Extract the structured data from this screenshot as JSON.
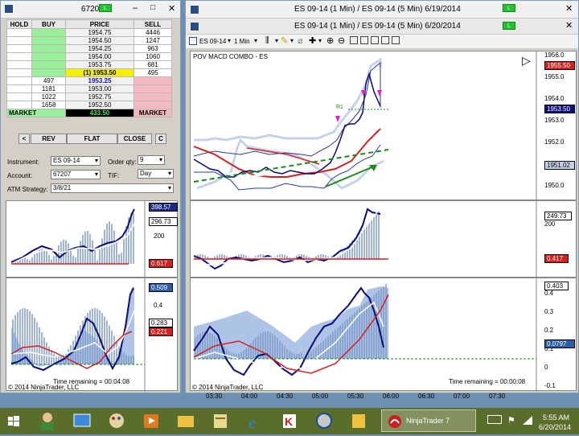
{
  "dom_window": {
    "title": "6720",
    "l_button": "L",
    "hold": "HOLD",
    "buy": "BUY",
    "price": "PRICE",
    "sell": "SELL",
    "rows": [
      {
        "buy": "",
        "price": "1954.75",
        "sell": "4446"
      },
      {
        "buy": "",
        "price": "1954.50",
        "sell": "1247"
      },
      {
        "buy": "",
        "price": "1954.25",
        "sell": "963"
      },
      {
        "buy": "",
        "price": "1954.00",
        "sell": "1060"
      },
      {
        "buy": "",
        "price": "1953.75",
        "sell": "681"
      },
      {
        "buy": "",
        "price": "(1) 1953.50",
        "sell": "495"
      },
      {
        "buy": "497",
        "price": "1953.25",
        "sell": ""
      },
      {
        "buy": "1181",
        "price": "1953.00",
        "sell": ""
      },
      {
        "buy": "1022",
        "price": "1952.75",
        "sell": ""
      },
      {
        "buy": "1658",
        "price": "1952.50",
        "sell": ""
      }
    ],
    "market_left": "MARKET",
    "pnl": "433.50",
    "market_right": "MARKET",
    "btn_lt": "<",
    "btn_rev": "REV",
    "btn_flat": "FLAT",
    "btn_close": "CLOSE",
    "btn_c": "C",
    "instrument_label": "Instrument:",
    "instrument": "ES 09-14",
    "orderqty_label": "Order qty:",
    "orderqty": "9",
    "account_label": "Account:",
    "account": "67207",
    "tif_label": "TIF:",
    "tif": "Day",
    "atm_label": "ATM Strategy:",
    "atm": "3/8/21",
    "macd_tag1": "398.57",
    "macd_axis": "200",
    "macd_tag2": "296.73",
    "macd_tag3": "0.617",
    "osc_tag1": "0.509",
    "osc_axis": "0.4",
    "osc_tag2": "0.283",
    "osc_tag3": "0.221",
    "time_remaining": "Time remaining = 00:04:08",
    "copyright": "© 2014 NinjaTrader, LLC"
  },
  "chart_window": {
    "title_1": "ES 09-14 (1 Min) / ES 09-14 (5 Min)  6/19/2014",
    "title_2": "ES 09-14 (1 Min) / ES 09-14 (5 Min)  6/20/2014",
    "l_button": "L",
    "instrument_dd": "ES 09-14",
    "interval_dd": "1 Min",
    "indicator_label": "POV MACD COMBO - ES",
    "r1_label": "R1",
    "price_ticks": [
      "1956.0",
      "1955.0",
      "1954.0",
      "1953.0",
      "1952.0",
      "1951.0",
      "1950.0"
    ],
    "price_tag_top": "1955.50",
    "price_tag_mid": "1953.50",
    "price_tag_low": "1951.02",
    "macd_tag": "249.73",
    "macd_axis": "200",
    "macd_neg": "0.417",
    "osc_ticks": [
      "0.4",
      "0.3",
      "0.2",
      "0.1",
      "0",
      "-0.1"
    ],
    "osc_tag": "0.403",
    "osc_tag2": "0.0797",
    "time_labels": [
      "03:30",
      "04:00",
      "04:30",
      "05:00",
      "05:30",
      "06:00",
      "06:30",
      "07:00",
      "07:30"
    ],
    "time_remaining": "Time remaining = 00:00:08",
    "copyright": "© 2014 NinjaTrader, LLC"
  },
  "taskbar": {
    "app_label": "NinjaTrader 7",
    "time": "5:55 AM",
    "date": "6/20/2014"
  },
  "colors": {
    "green": "#22c12f",
    "buy_bg": "#9af09a",
    "sell_bg": "#f4b8c0",
    "price_bg": "#f2f2f2",
    "navy": "#0a0a78",
    "red": "#d42020"
  }
}
